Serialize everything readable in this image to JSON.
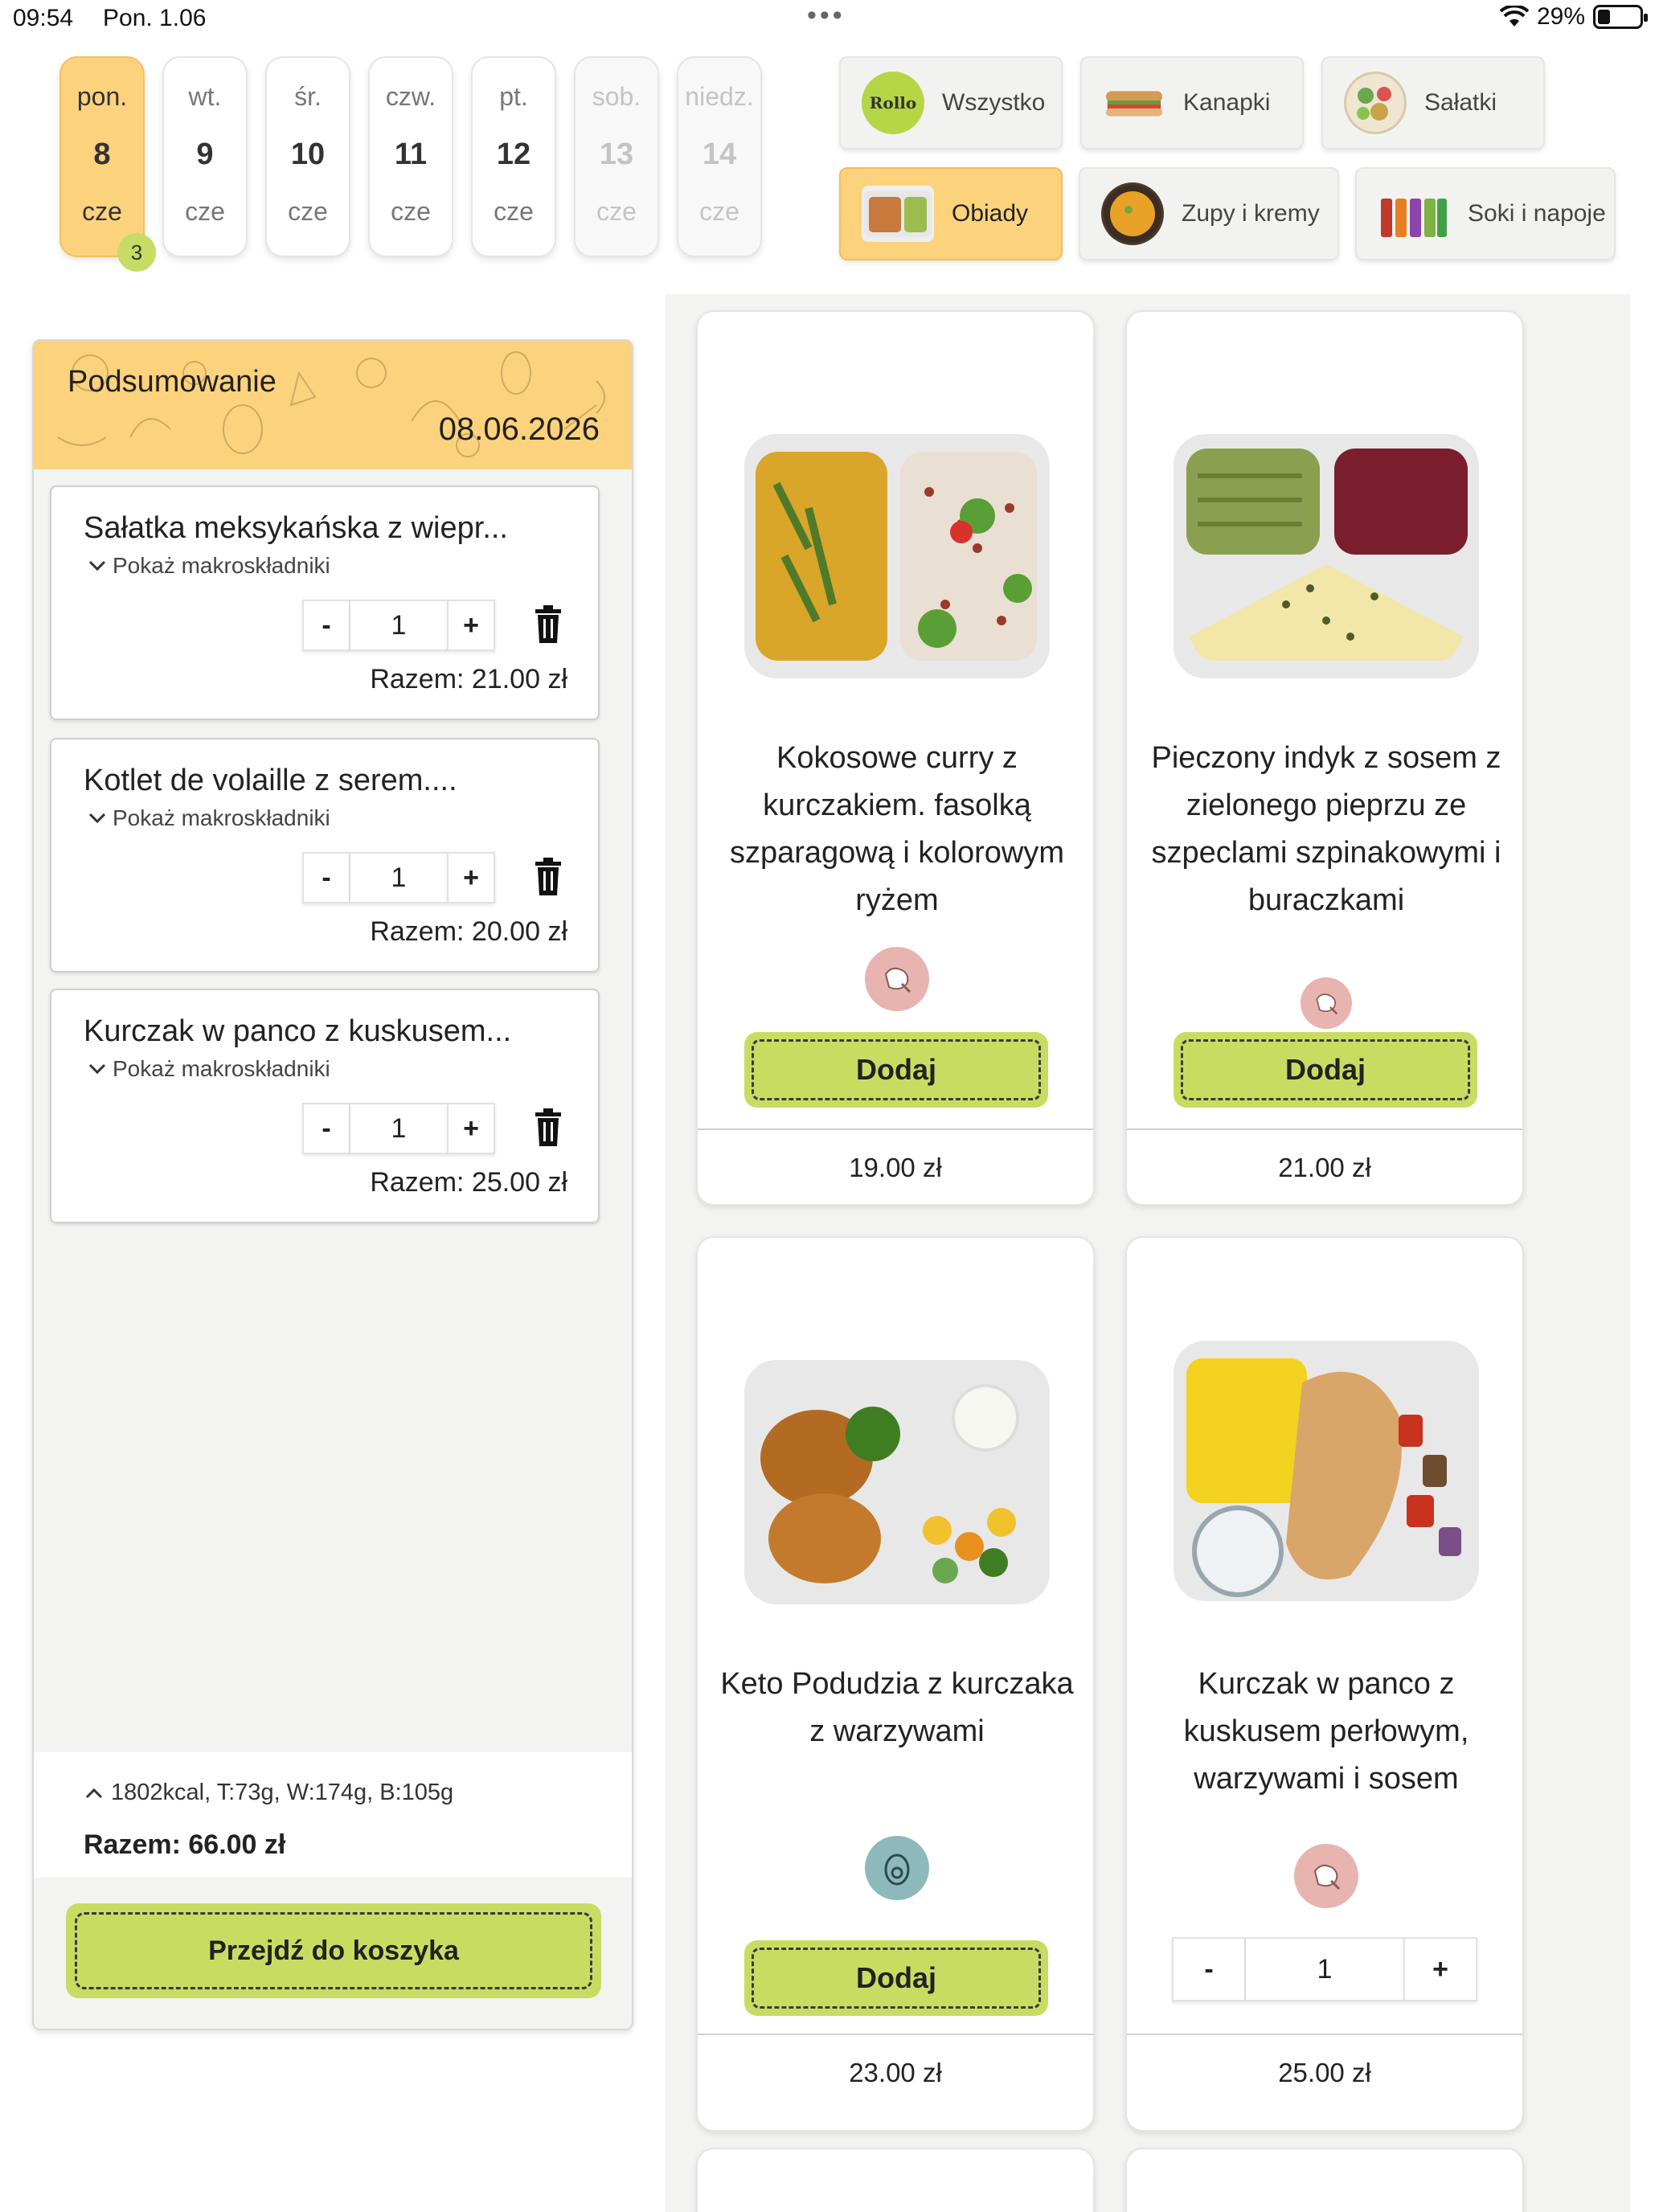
{
  "status_bar": {
    "time": "09:54",
    "date": "Pon. 1.06",
    "battery": "29%",
    "battery_level": 0.29
  },
  "days": [
    {
      "name": "pon.",
      "num": "8",
      "month": "cze",
      "state": "active",
      "badge": "3"
    },
    {
      "name": "wt.",
      "num": "9",
      "month": "cze",
      "state": "normal"
    },
    {
      "name": "śr.",
      "num": "10",
      "month": "cze",
      "state": "normal"
    },
    {
      "name": "czw.",
      "num": "11",
      "month": "cze",
      "state": "normal"
    },
    {
      "name": "pt.",
      "num": "12",
      "month": "cze",
      "state": "normal"
    },
    {
      "name": "sob.",
      "num": "13",
      "month": "cze",
      "state": "disabled"
    },
    {
      "name": "niedz.",
      "num": "14",
      "month": "cze",
      "state": "disabled"
    }
  ],
  "categories": [
    {
      "label": "Wszystko",
      "icon": "mr-rollo-logo-icon",
      "active": false
    },
    {
      "label": "Kanapki",
      "icon": "sandwich-icon",
      "active": false
    },
    {
      "label": "Sałatki",
      "icon": "salad-bowl-icon",
      "active": false
    },
    {
      "label": "Obiady",
      "icon": "dinner-tray-icon",
      "active": true
    },
    {
      "label": "Zupy i kremy",
      "icon": "soup-bowl-icon",
      "active": false
    },
    {
      "label": "Soki i napoje",
      "icon": "juice-bottles-icon",
      "active": false
    }
  ],
  "summary": {
    "title": "Podsumowanie",
    "date": "08.06.2026",
    "items": [
      {
        "name": "Sałatka meksykańska z wiepr...",
        "macro_toggle": "Pokaż makroskładniki",
        "qty": "1",
        "total": "Razem: 21.00 zł"
      },
      {
        "name": "Kotlet de volaille z serem....",
        "macro_toggle": "Pokaż makroskładniki",
        "qty": "1",
        "total": "Razem: 20.00 zł"
      },
      {
        "name": "Kurczak w panco z kuskusem...",
        "macro_toggle": "Pokaż makroskładniki",
        "qty": "1",
        "total": "Razem: 25.00 zł"
      }
    ],
    "macros": "1802kcal, T:73g, W:174g, B:105g",
    "grand_total": "Razem: 66.00 zł",
    "checkout_label": "Przejdź do koszyka"
  },
  "stepper": {
    "minus": "-",
    "plus": "+"
  },
  "products": [
    {
      "name": "Kokosowe curry z kurczakiem. fasolką szparagową i kolorowym ryżem",
      "icon": "chicken-leg-icon",
      "action": "Dodaj",
      "price": "19.00 zł",
      "in_cart": false
    },
    {
      "name": "Pieczony indyk z sosem z zielonego pieprzu ze szpeclami szpinakowymi i buraczkami",
      "icon": "chicken-leg-icon",
      "action": "Dodaj",
      "price": "21.00 zł",
      "in_cart": false
    },
    {
      "name": "Keto Podudzia z kurczaka z warzywami",
      "icon": "keto-avocado-icon",
      "action": "Dodaj",
      "price": "23.00 zł",
      "in_cart": false
    },
    {
      "name": "Kurczak w panco z kuskusem perłowym, warzywami i sosem",
      "icon": "chicken-leg-icon",
      "qty": "1",
      "price": "25.00 zł",
      "in_cart": true
    }
  ],
  "colors": {
    "accent_yellow": "#fdd27d",
    "accent_green": "#c9dc62",
    "panel_bg": "#f3f4f2",
    "meat_icon_bg": "#e8b4b0",
    "keto_icon_bg": "#8db9bd"
  }
}
